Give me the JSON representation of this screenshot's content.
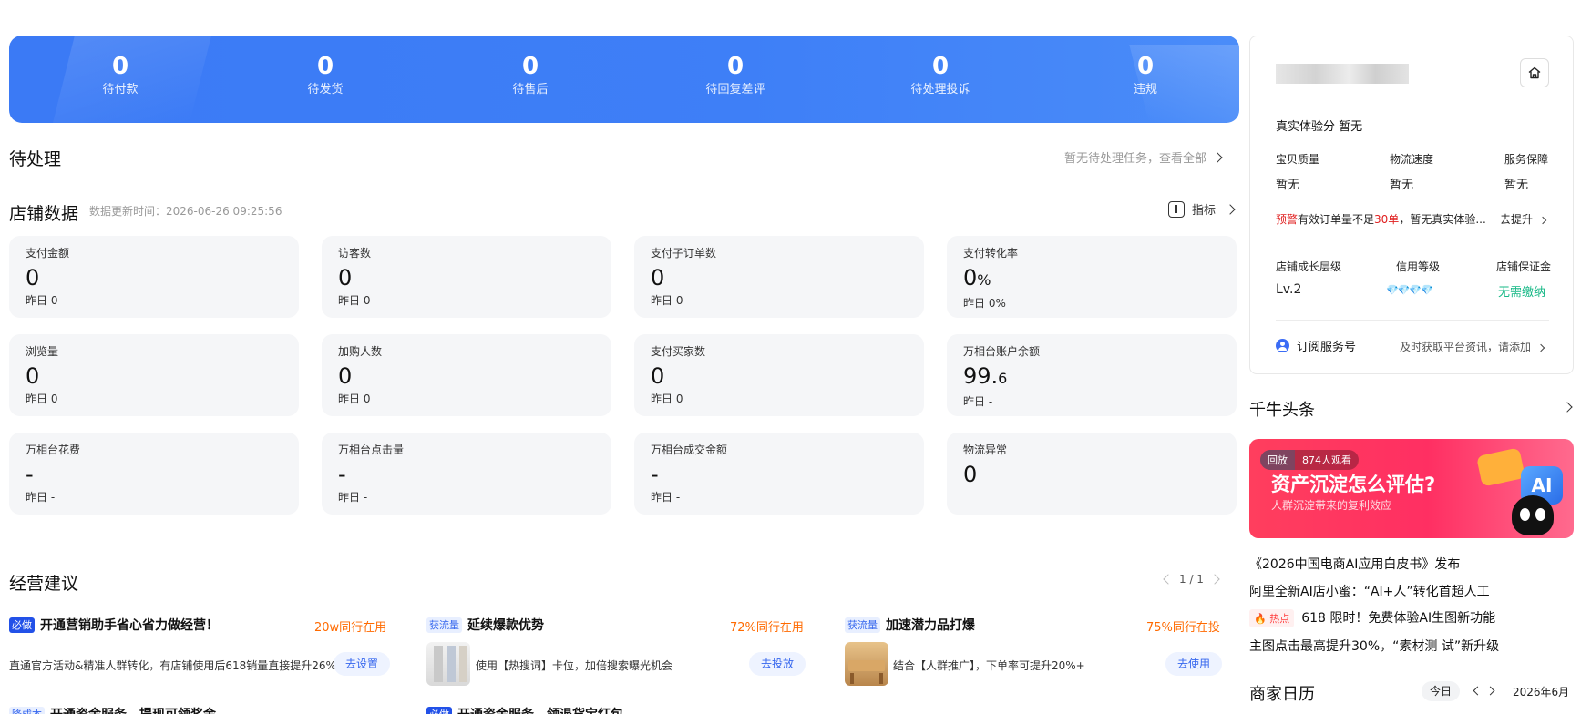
{
  "banner": {
    "stats": [
      {
        "value": "0",
        "label": "待付款"
      },
      {
        "value": "0",
        "label": "待发货"
      },
      {
        "value": "0",
        "label": "待售后"
      },
      {
        "value": "0",
        "label": "待回复差评"
      },
      {
        "value": "0",
        "label": "待处理投诉"
      },
      {
        "value": "0",
        "label": "违规"
      }
    ]
  },
  "pending": {
    "title": "待处理",
    "link": "暂无待处理任务，查看全部"
  },
  "store": {
    "title": "店铺数据",
    "updated": "数据更新时间：2026-06-26 09:25:56",
    "metrics_label": "指标",
    "cards": [
      {
        "title": "支付金额",
        "value": "0",
        "unit": "",
        "yesterday": "昨日 0"
      },
      {
        "title": "访客数",
        "value": "0",
        "unit": "",
        "yesterday": "昨日 0"
      },
      {
        "title": "支付子订单数",
        "value": "0",
        "unit": "",
        "yesterday": "昨日 0"
      },
      {
        "title": "支付转化率",
        "value": "0",
        "unit": "%",
        "yesterday": "昨日 0%"
      },
      {
        "title": "浏览量",
        "value": "0",
        "unit": "",
        "yesterday": "昨日 0"
      },
      {
        "title": "加购人数",
        "value": "0",
        "unit": "",
        "yesterday": "昨日 0"
      },
      {
        "title": "支付买家数",
        "value": "0",
        "unit": "",
        "yesterday": "昨日 0"
      },
      {
        "title": "万相台账户余额",
        "value": "99.",
        "unit": "6",
        "yesterday": "昨日 -"
      },
      {
        "title": "万相台花费",
        "value": "-",
        "unit": "",
        "yesterday": "昨日 -"
      },
      {
        "title": "万相台点击量",
        "value": "-",
        "unit": "",
        "yesterday": "昨日 -"
      },
      {
        "title": "万相台成交金额",
        "value": "-",
        "unit": "",
        "yesterday": "昨日 -"
      },
      {
        "title": "物流异常",
        "value": "0",
        "unit": "",
        "yesterday": ""
      }
    ]
  },
  "advice": {
    "title": "经营建议",
    "pager": "1 / 1",
    "items": [
      {
        "tag": "必做",
        "title": "开通营销助手省心省力做经营！",
        "stat": "20w同行在用",
        "desc": "直通官方活动&精准人群转化，有店铺使用后618销量直接提升26%",
        "button": "去设置"
      },
      {
        "tag": "获流量",
        "title": "延续爆款优势",
        "stat": "72%同行在用",
        "desc": "使用【热搜词】卡位，加倍搜索曝光机会",
        "button": "去投放"
      },
      {
        "tag": "获流量",
        "title": "加速潜力品打爆",
        "stat": "75%同行在投",
        "desc": "结合【人群推广】，下单率可提升20%+",
        "button": "去使用"
      }
    ],
    "cut_items": [
      {
        "tag": "降成本",
        "title": "开通资金服务，提现可领奖金"
      },
      {
        "tag": "必做",
        "title": "开通资金服务，领退货宝红包"
      }
    ]
  },
  "side": {
    "experience_label": "真实体验分",
    "experience_value": "暂无",
    "sub_scores": [
      {
        "label": "宝贝质量",
        "value": "暂无"
      },
      {
        "label": "物流速度",
        "value": "暂无"
      },
      {
        "label": "服务保障",
        "value": "暂无"
      }
    ],
    "warn_tag": "预警",
    "warn_text_a": "有效订单量不足",
    "warn_num": "30单",
    "warn_text_b": "，暂无真实体验...",
    "warn_link": "去提升",
    "levels": [
      {
        "label": "店铺成长层级",
        "value": "Lv.2"
      },
      {
        "label": "信用等级",
        "value": "💎💎💎💎"
      },
      {
        "label": "店铺保证金",
        "value": "无需缴纳"
      }
    ],
    "subscribe_label": "订阅服务号",
    "subscribe_desc": "及时获取平台资讯，请添加",
    "colors": {
      "warn": "#e02020",
      "green": "#16b886",
      "accent": "#3b7af5"
    }
  },
  "headlines": {
    "title": "千牛头条",
    "banner_tag": "回放",
    "banner_viewers": "874人观看",
    "banner_title": "资产沉淀怎么评估?",
    "banner_sub": "人群沉淀带来的复利效应",
    "news": [
      {
        "text": "《2026中国电商AI应用白皮书》发布",
        "hot": ""
      },
      {
        "text": "阿里全新AI店小蜜：“AI+人”转化首超人工",
        "hot": ""
      },
      {
        "text": "618 限时！免费体验AI生图新功能",
        "hot": "热点"
      },
      {
        "text": "主图点击最高提升30%，“素材测 试”新升级",
        "hot": ""
      }
    ]
  },
  "calendar": {
    "title": "商家日历",
    "today": "今日",
    "month": "2026年6月"
  }
}
